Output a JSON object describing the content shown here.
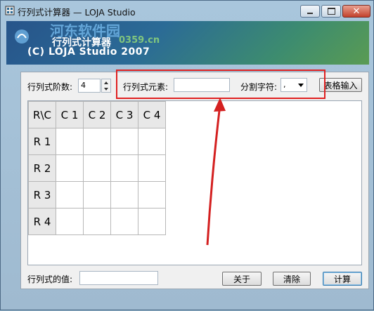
{
  "window": {
    "title": "行列式计算器 — LOJA Studio"
  },
  "banner": {
    "title": "行列式计算器",
    "subtitle": "(C) LOJA Studio  2007",
    "watermark": "河东软件园",
    "watermark_url": "0359.cn"
  },
  "order": {
    "label": "行列式阶数:",
    "value": "4"
  },
  "element": {
    "label": "行列式元素:",
    "value": ""
  },
  "separator": {
    "label": "分割字符:",
    "value": ","
  },
  "buttons": {
    "table_input": "表格输入",
    "about": "关于",
    "clear": "清除",
    "compute": "计算"
  },
  "grid": {
    "corner": "R\\C",
    "col_headers": [
      "C 1",
      "C 2",
      "C 3",
      "C 4"
    ],
    "row_headers": [
      "R 1",
      "R 2",
      "R 3",
      "R 4"
    ]
  },
  "result": {
    "label": "行列式的值:",
    "value": ""
  },
  "colors": {
    "highlight": "#e02020",
    "arrow": "#d42020"
  }
}
